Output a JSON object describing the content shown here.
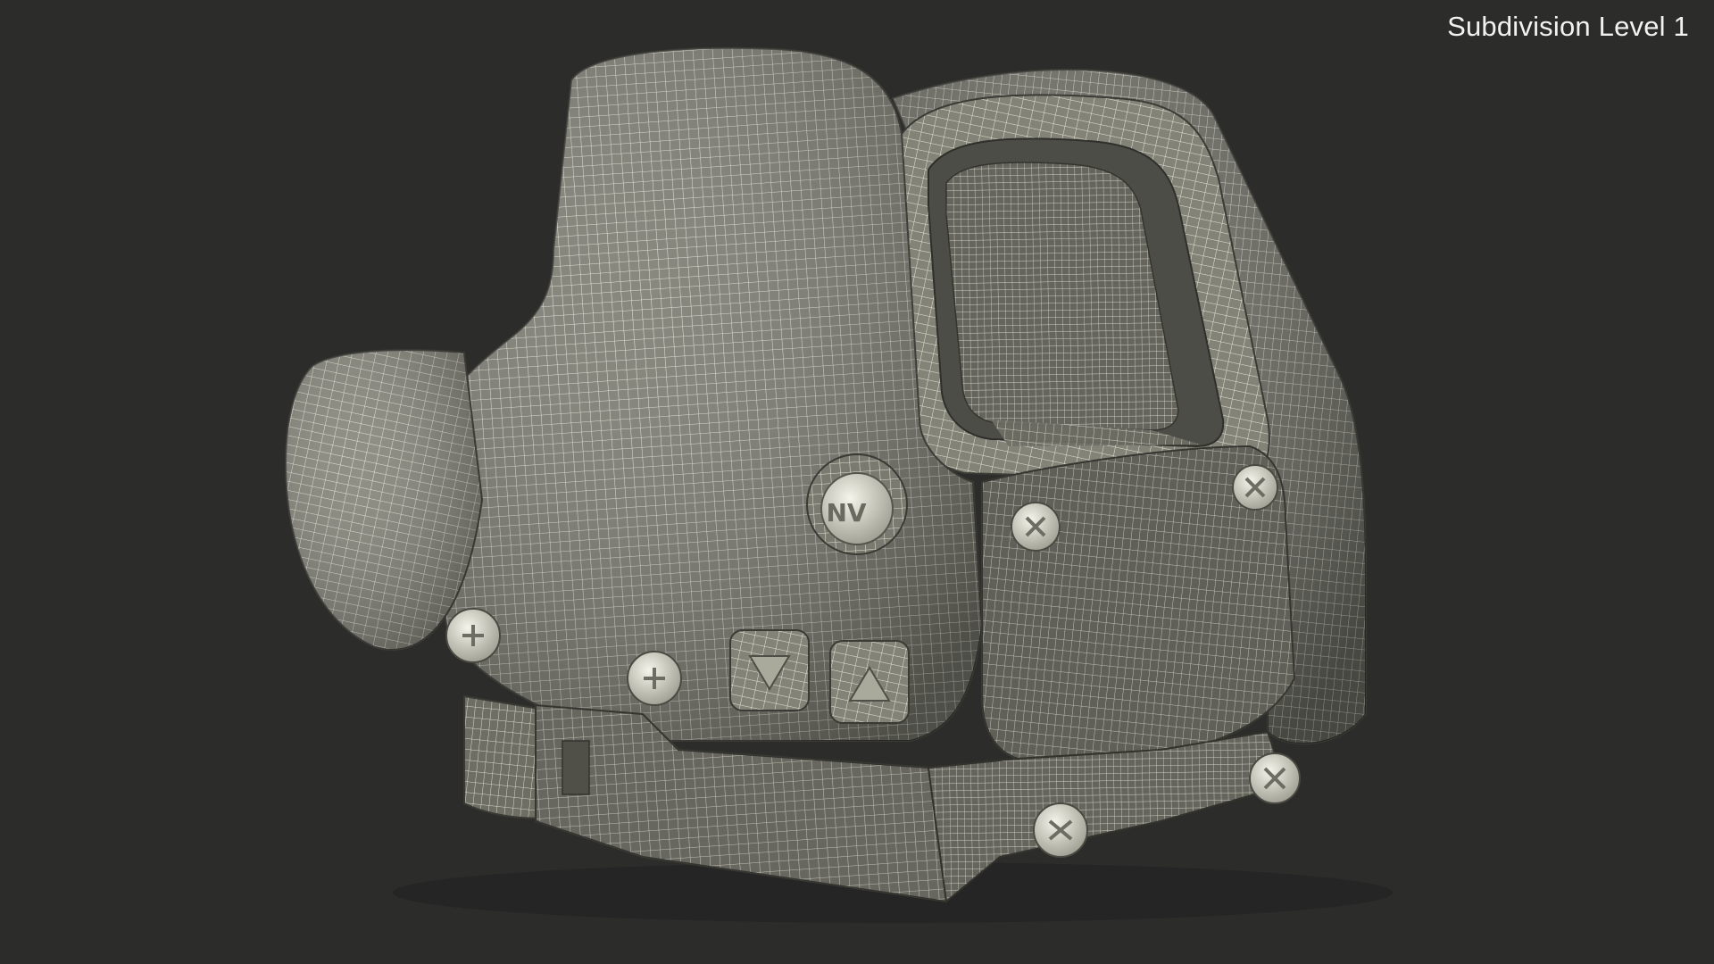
{
  "viewport": {
    "label": "Subdivision Level 1",
    "background_color": "#2c2c2b",
    "label_color": "#f2f2f2"
  },
  "model": {
    "subject": "holographic-weapon-sight",
    "display_mode": "wireframe-on-shaded",
    "surface_color": "#7d7d72",
    "wire_color": "#e4e4d8",
    "emboss_text": "NV"
  }
}
